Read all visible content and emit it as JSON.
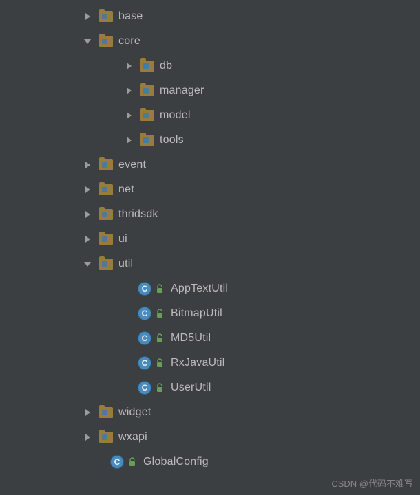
{
  "tree": [
    {
      "indent": 120,
      "kind": "folder",
      "expanded": false,
      "label": "base"
    },
    {
      "indent": 120,
      "kind": "folder",
      "expanded": true,
      "label": "core"
    },
    {
      "indent": 180,
      "kind": "folder",
      "expanded": false,
      "label": "db"
    },
    {
      "indent": 180,
      "kind": "folder",
      "expanded": false,
      "label": "manager"
    },
    {
      "indent": 180,
      "kind": "folder",
      "expanded": false,
      "label": "model"
    },
    {
      "indent": 180,
      "kind": "folder",
      "expanded": false,
      "label": "tools"
    },
    {
      "indent": 120,
      "kind": "folder",
      "expanded": false,
      "label": "event"
    },
    {
      "indent": 120,
      "kind": "folder",
      "expanded": false,
      "label": "net"
    },
    {
      "indent": 120,
      "kind": "folder",
      "expanded": false,
      "label": "thridsdk"
    },
    {
      "indent": 120,
      "kind": "folder",
      "expanded": false,
      "label": "ui"
    },
    {
      "indent": 120,
      "kind": "folder",
      "expanded": true,
      "label": "util"
    },
    {
      "indent": 200,
      "kind": "class",
      "label": "AppTextUtil"
    },
    {
      "indent": 200,
      "kind": "class",
      "label": "BitmapUtil"
    },
    {
      "indent": 200,
      "kind": "class",
      "label": "MD5Util"
    },
    {
      "indent": 200,
      "kind": "class",
      "label": "RxJavaUtil"
    },
    {
      "indent": 200,
      "kind": "class",
      "label": "UserUtil"
    },
    {
      "indent": 120,
      "kind": "folder",
      "expanded": false,
      "label": "widget"
    },
    {
      "indent": 120,
      "kind": "folder",
      "expanded": false,
      "label": "wxapi"
    },
    {
      "indent": 160,
      "kind": "class",
      "label": "GlobalConfig"
    }
  ],
  "icons": {
    "class_letter": "C"
  },
  "watermark": "CSDN @代码不难写"
}
